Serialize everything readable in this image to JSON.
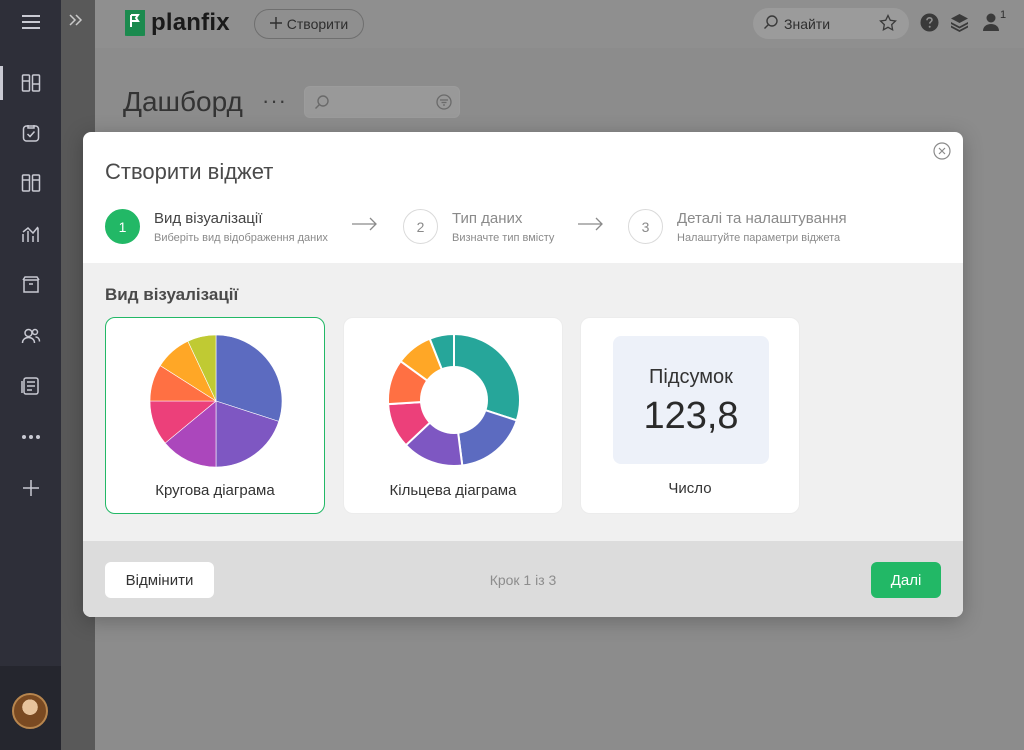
{
  "app": {
    "logo_text": "planfix",
    "create_label": "Створити",
    "search_label": "Знайти",
    "notification_count": "1",
    "brand_color": "#22b866"
  },
  "rail": {
    "items": [
      "menu-icon",
      "dashboard-icon",
      "tasks-icon",
      "projects-icon",
      "analytics-icon",
      "archive-icon",
      "contacts-icon",
      "documents-icon",
      "more-icon",
      "add-icon"
    ]
  },
  "page": {
    "title": "Дашборд",
    "more": "···"
  },
  "modal": {
    "title": "Створити віджет",
    "steps": [
      {
        "num": "1",
        "title": "Вид візуалізації",
        "desc": "Виберіть вид відображення даних"
      },
      {
        "num": "2",
        "title": "Тип даних",
        "desc": "Визначте тип вмісту"
      },
      {
        "num": "3",
        "title": "Деталі та налаштування",
        "desc": "Налаштуйте параметри віджета"
      }
    ],
    "section_label": "Вид візуалізації",
    "cards": [
      {
        "label": "Кругова діаграма",
        "selected": true
      },
      {
        "label": "Кільцева діаграма",
        "selected": false
      },
      {
        "label": "Число",
        "selected": false
      }
    ],
    "number_card": {
      "caption": "Підсумок",
      "value": "123,8"
    },
    "cancel_label": "Відмінити",
    "step_count": "Крок 1 із 3",
    "next_label": "Далі"
  },
  "pie_colors": [
    "#5c6bc0",
    "#7e57c2",
    "#ab47bc",
    "#ec407a",
    "#ff7043",
    "#ffa726",
    "#c0ca33"
  ],
  "donut_colors": [
    "#26a69a",
    "#5c6bc0",
    "#7e57c2",
    "#ec407a",
    "#ff7043",
    "#ffa726"
  ]
}
